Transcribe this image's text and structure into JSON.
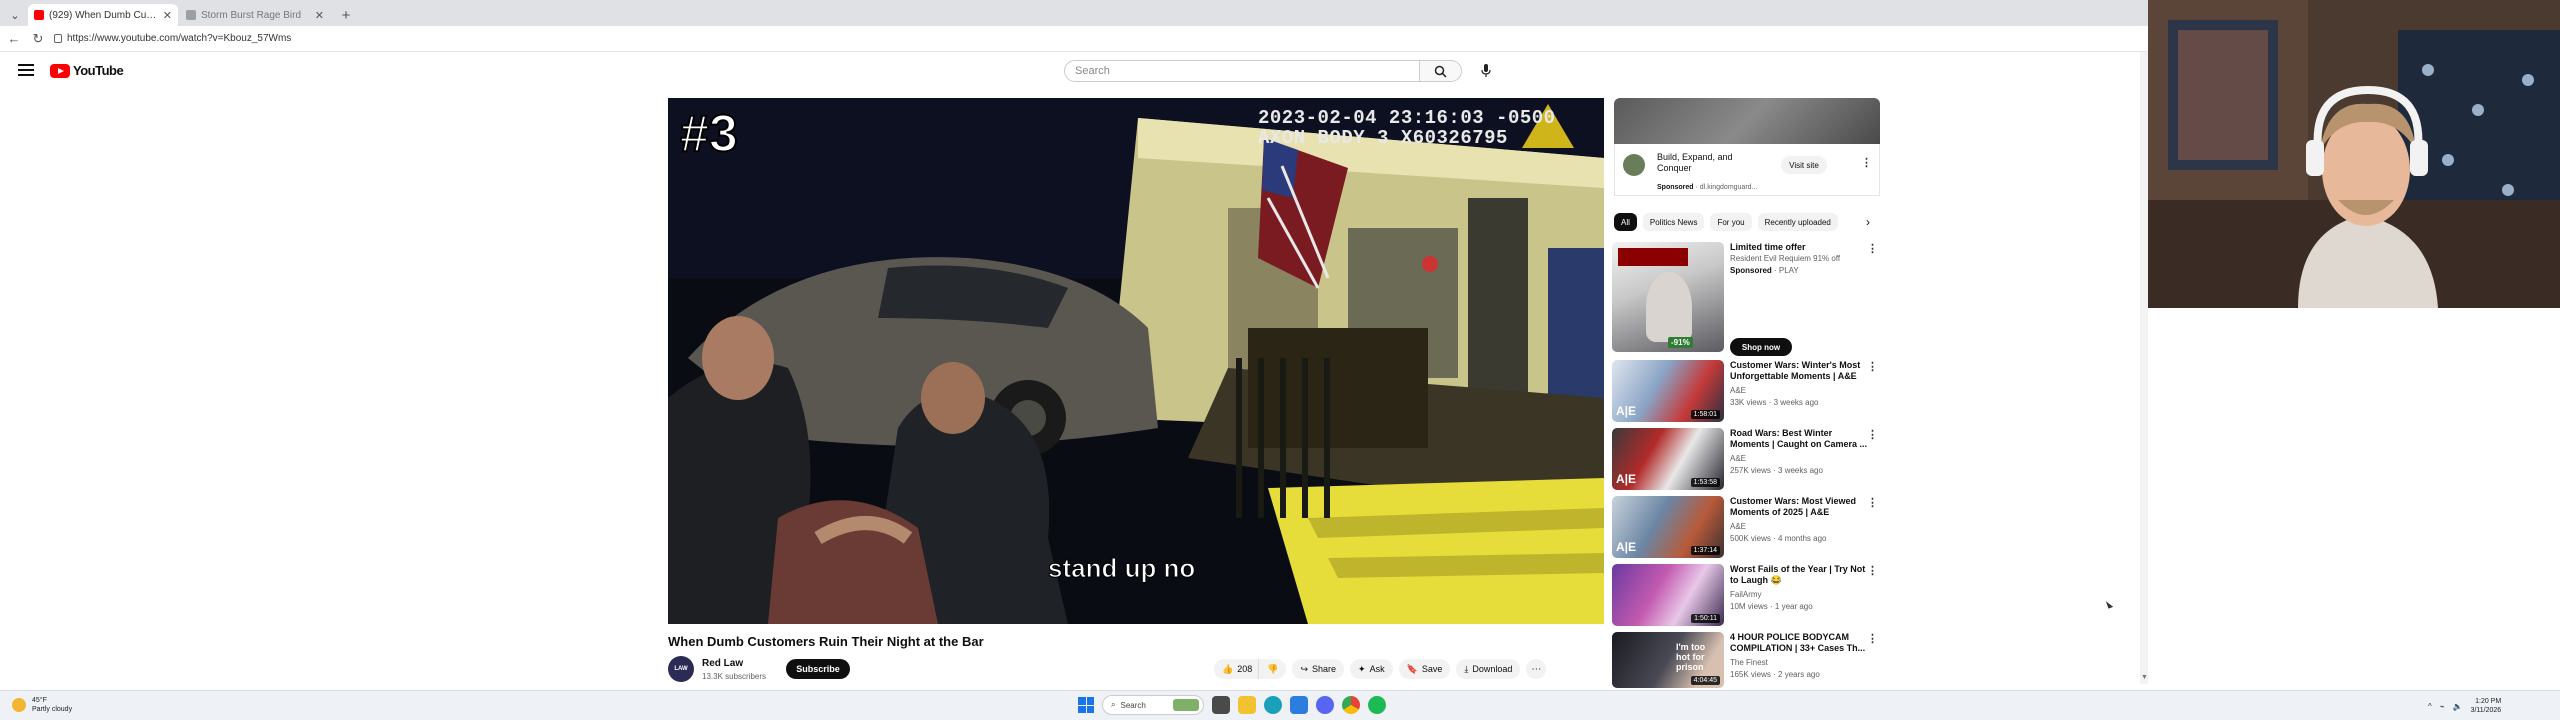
{
  "browser": {
    "tabs": [
      {
        "title": "(929) When Dumb Customers Ruin Their Night at the Bar",
        "active": true
      },
      {
        "title": "Storm Burst Rage Bird",
        "active": false
      }
    ],
    "url": "https://www.youtube.com/watch?v=Kbouz_57Wms"
  },
  "youtube": {
    "logo_text": "YouTube",
    "search_placeholder": "Search"
  },
  "video": {
    "overlay_number": "#3",
    "timestamp_line1": "2023-02-04 23:16:03 -0500",
    "timestamp_line2": "AXON BODY 3 X60326795",
    "subtitle": "stand up no",
    "title": "When Dumb Customers Ruin Their Night at the Bar",
    "channel": {
      "name": "Red Law",
      "subscribers": "13.3K subscribers",
      "avatar_text": "LAW"
    },
    "subscribe_label": "Subscribe",
    "actions": {
      "likes": "208",
      "share": "Share",
      "ask": "Ask",
      "save": "Save",
      "download": "Download"
    }
  },
  "sidebar": {
    "ad": {
      "title": "Build, Expand, and Conquer",
      "sponsored": "Sponsored",
      "domain": "dl.kingdomguard...",
      "visit_label": "Visit site"
    },
    "chips": [
      "All",
      "Politics News",
      "For you",
      "Recently uploaded"
    ],
    "promo": {
      "title": "Limited time offer",
      "subtitle": "Resident Evil Requiem 91% off",
      "sponsored": "Sponsored",
      "store": "PLAY",
      "discount": "-91%",
      "shop_label": "Shop now"
    },
    "recommendations": [
      {
        "title": "Customer Wars: Winter's Most Unforgettable Moments | A&E",
        "channel": "A&E",
        "meta": "33K views · 3 weeks ago",
        "duration": "1:58:01"
      },
      {
        "title": "Road Wars: Best Winter Moments | Caught on Camera ...",
        "channel": "A&E",
        "meta": "257K views · 3 weeks ago",
        "duration": "1:53:58"
      },
      {
        "title": "Customer Wars: Most Viewed Moments of 2025 | A&E",
        "channel": "A&E",
        "meta": "500K views · 4 months ago",
        "duration": "1:37:14"
      },
      {
        "title": "Worst Fails of the Year | Try Not to Laugh 😂",
        "channel": "FailArmy",
        "meta": "10M views · 1 year ago",
        "duration": "1:50:11"
      },
      {
        "title": "4 HOUR POLICE BODYCAM COMPILATION | 33+ Cases Th...",
        "channel": "The Finest",
        "meta": "165K views · 2 years ago",
        "duration": "4:04:45"
      }
    ]
  },
  "taskbar": {
    "weather_temp": "45°F",
    "weather_desc": "Partly cloudy",
    "search_label": "Search",
    "time": "1:20 PM",
    "date": "3/11/2026"
  },
  "colors": {
    "yt_red": "#ff0000",
    "accent_black": "#0f0f0f"
  }
}
